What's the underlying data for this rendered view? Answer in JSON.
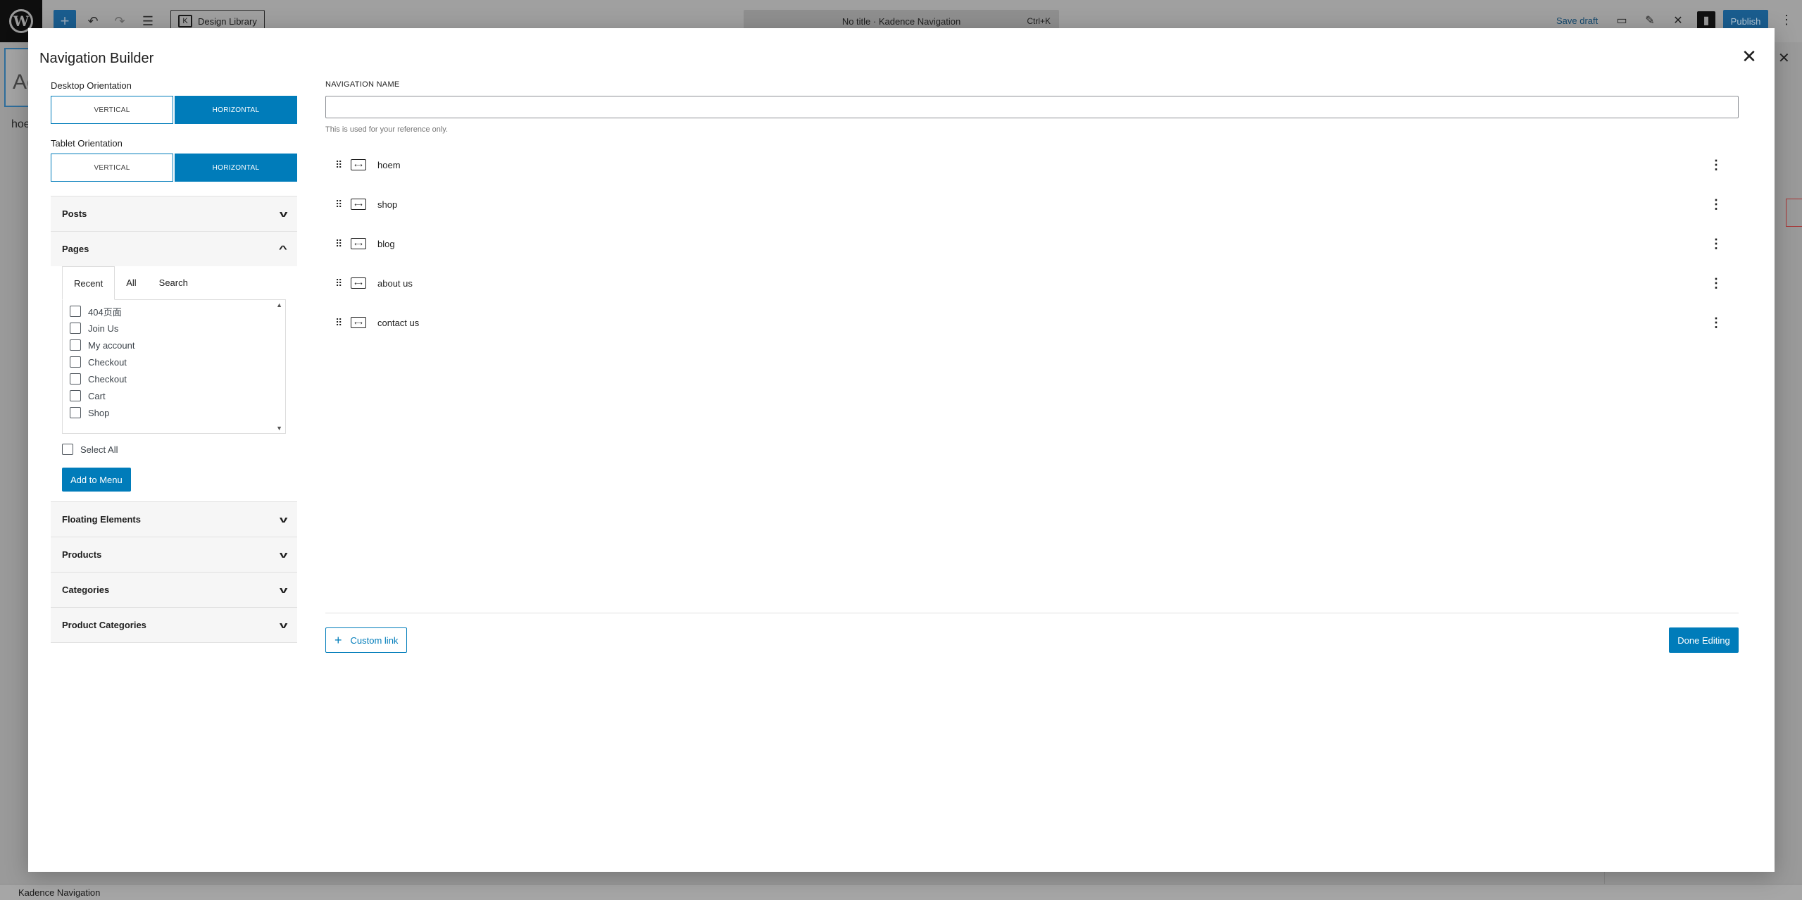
{
  "editor": {
    "design_library_label": "Design Library",
    "command_bar_title": "No title · Kadence Navigation",
    "command_bar_shortcut": "Ctrl+K",
    "save_draft_label": "Save draft",
    "publish_label": "Publish",
    "title_placeholder_fragment": "Ac",
    "content_fragment": "hoe",
    "footer_breadcrumb": "Kadence Navigation"
  },
  "modal": {
    "title": "Navigation Builder",
    "desktop_orientation_label": "Desktop Orientation",
    "tablet_orientation_label": "Tablet Orientation",
    "orientation_options": {
      "vertical": "VERTICAL",
      "horizontal": "HORIZONTAL"
    },
    "desktop_orientation_selected": "HORIZONTAL",
    "tablet_orientation_selected": "HORIZONTAL",
    "accordions": {
      "posts": "Posts",
      "pages": "Pages",
      "floating_elements": "Floating Elements",
      "products": "Products",
      "categories": "Categories",
      "product_categories": "Product Categories"
    },
    "pages_tabs": {
      "recent": "Recent",
      "all": "All",
      "search": "Search",
      "active": "Recent"
    },
    "pages_list": [
      "404页面",
      "Join Us",
      "My account",
      "Checkout",
      "Checkout",
      "Cart",
      "Shop"
    ],
    "select_all_label": "Select All",
    "add_to_menu_label": "Add to Menu",
    "navigation_name_label": "NAVIGATION NAME",
    "navigation_name_value": "",
    "navigation_name_help": "This is used for your reference only.",
    "menu_items": [
      "hoem",
      "shop",
      "blog",
      "about us",
      "contact us"
    ],
    "custom_link_label": "Custom link",
    "done_editing_label": "Done Editing"
  },
  "colors": {
    "accent": "#007cba",
    "overlay": "#9a9a9a",
    "modal_bg": "#ffffff",
    "accordion_bg": "#f6f6f6"
  },
  "icons": {
    "close": "close-icon",
    "chevron_down": "chevron-down-icon",
    "chevron_up": "chevron-up-icon",
    "drag_handle": "drag-handle-icon",
    "link": "link-icon",
    "more_vertical": "more-vertical-icon",
    "plus": "plus-icon"
  }
}
